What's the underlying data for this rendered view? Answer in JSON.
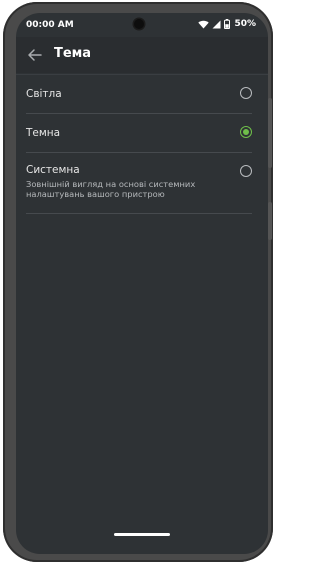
{
  "status_bar": {
    "time": "00:00 AM",
    "battery_percent": "50%",
    "icons": [
      "wifi-icon",
      "cellular-signal-icon",
      "battery-icon"
    ]
  },
  "app_bar": {
    "back_icon": "arrow-left-icon",
    "title": "Тема"
  },
  "theme_options": [
    {
      "label": "Світла",
      "description": "",
      "selected": false
    },
    {
      "label": "Темна",
      "description": "",
      "selected": true
    },
    {
      "label": "Системна",
      "description": "Зовнішній вигляд на основі системних налаштувань вашого пристрою",
      "selected": false
    }
  ],
  "colors": {
    "background": "#2e3235",
    "accent": "#6fbf4a",
    "text_primary": "#e6e6e6",
    "text_secondary": "#b6b9bc"
  }
}
